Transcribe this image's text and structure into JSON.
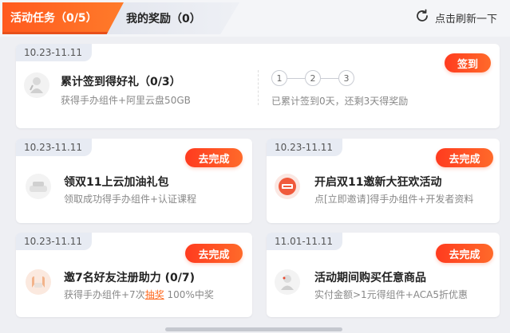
{
  "tabs": {
    "active_label": "活动任务（0/5）",
    "inactive_label": "我的奖励（0）"
  },
  "refresh_label": "点击刷新一下",
  "checkin": {
    "date": "10.23-11.11",
    "title": "累计签到得好礼（0/3）",
    "desc": "获得手办组件+阿里云盘50GB",
    "button": "签到",
    "steps": [
      "1",
      "2",
      "3"
    ],
    "progress_text": "已累计签到0天，还剩3天得奖励"
  },
  "tasks": [
    {
      "date": "10.23-11.11",
      "title": "领双11上云加油礼包",
      "desc": "领取成功得手办组件+认证课程",
      "button": "去完成"
    },
    {
      "date": "10.23-11.11",
      "title": "开启双11邀新大狂欢活动",
      "desc": "点[立即邀请]得手办组件+开发者资料",
      "button": "去完成"
    },
    {
      "date": "10.23-11.11",
      "title": "邀7名好友注册助力 (0/7)",
      "desc_prefix": "获得手办组件+7次",
      "desc_link": "抽奖",
      "desc_suffix": " 100%中奖",
      "button": "去完成"
    },
    {
      "date": "11.01-11.11",
      "title": "活动期间购买任意商品",
      "desc": "实付金额>1元得组件+ACA5折优惠",
      "button": "去完成"
    }
  ],
  "colors": {
    "accent": "#ff5a1f",
    "button_gradient_start": "#ff3b1f",
    "button_gradient_end": "#ff6a2a"
  }
}
